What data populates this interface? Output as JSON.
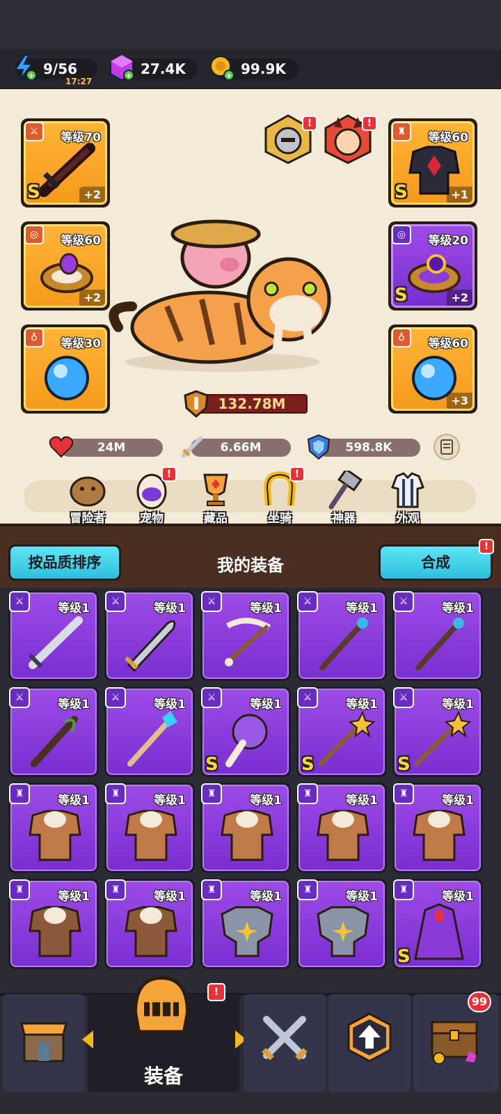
{
  "currencies": {
    "energy": {
      "value": "9/56",
      "timer": "17:27"
    },
    "gems": {
      "value": "27.4K"
    },
    "coins": {
      "value": "99.9K"
    }
  },
  "equipped": {
    "weapon": {
      "level": "等级70",
      "bonus": "+2",
      "rarity": "S"
    },
    "ring_left": {
      "level": "等级60",
      "bonus": "+2"
    },
    "amulet_left": {
      "level": "等级30"
    },
    "armor": {
      "level": "等级60",
      "bonus": "+1",
      "rarity": "S"
    },
    "ring_right": {
      "level": "等级20",
      "bonus": "+2",
      "rarity": "S"
    },
    "amulet_right": {
      "level": "等级60",
      "bonus": "+3"
    }
  },
  "portrait_alert": "!",
  "power": "132.78M",
  "stats": {
    "hp": "24M",
    "attack": "6.66M",
    "defense": "598.8K"
  },
  "menu": [
    {
      "label": "冒险者",
      "icon": "capybara-icon"
    },
    {
      "label": "宠物",
      "icon": "egg-icon",
      "alert": "!"
    },
    {
      "label": "藏品",
      "icon": "trophy-icon"
    },
    {
      "label": "坐骑",
      "icon": "horseshoe-icon",
      "alert": "!"
    },
    {
      "label": "神器",
      "icon": "hammer-icon"
    },
    {
      "label": "外观",
      "icon": "outfit-icon"
    }
  ],
  "inventory_header": {
    "sort_label": "按品质排序",
    "title": "我的装备",
    "merge_label": "合成",
    "merge_alert": "!"
  },
  "inventory": [
    {
      "level": "等级1",
      "type": "weapon",
      "rarity": ""
    },
    {
      "level": "等级1",
      "type": "weapon",
      "rarity": ""
    },
    {
      "level": "等级1",
      "type": "weapon",
      "rarity": ""
    },
    {
      "level": "等级1",
      "type": "weapon",
      "rarity": ""
    },
    {
      "level": "等级1",
      "type": "weapon",
      "rarity": ""
    },
    {
      "level": "等级1",
      "type": "weapon",
      "rarity": ""
    },
    {
      "level": "等级1",
      "type": "weapon",
      "rarity": ""
    },
    {
      "level": "等级1",
      "type": "weapon",
      "rarity": "S"
    },
    {
      "level": "等级1",
      "type": "weapon",
      "rarity": "S"
    },
    {
      "level": "等级1",
      "type": "weapon",
      "rarity": "S"
    },
    {
      "level": "等级1",
      "type": "armor",
      "rarity": ""
    },
    {
      "level": "等级1",
      "type": "armor",
      "rarity": ""
    },
    {
      "level": "等级1",
      "type": "armor",
      "rarity": ""
    },
    {
      "level": "等级1",
      "type": "armor",
      "rarity": ""
    },
    {
      "level": "等级1",
      "type": "armor",
      "rarity": ""
    },
    {
      "level": "等级1",
      "type": "armor",
      "rarity": ""
    },
    {
      "level": "等级1",
      "type": "armor",
      "rarity": ""
    },
    {
      "level": "等级1",
      "type": "armor",
      "rarity": ""
    },
    {
      "level": "等级1",
      "type": "armor",
      "rarity": ""
    },
    {
      "level": "等级1",
      "type": "armor",
      "rarity": "S"
    }
  ],
  "bottom_nav": {
    "active_label": "装备",
    "equip_alert": "!",
    "chest_count": "99"
  }
}
